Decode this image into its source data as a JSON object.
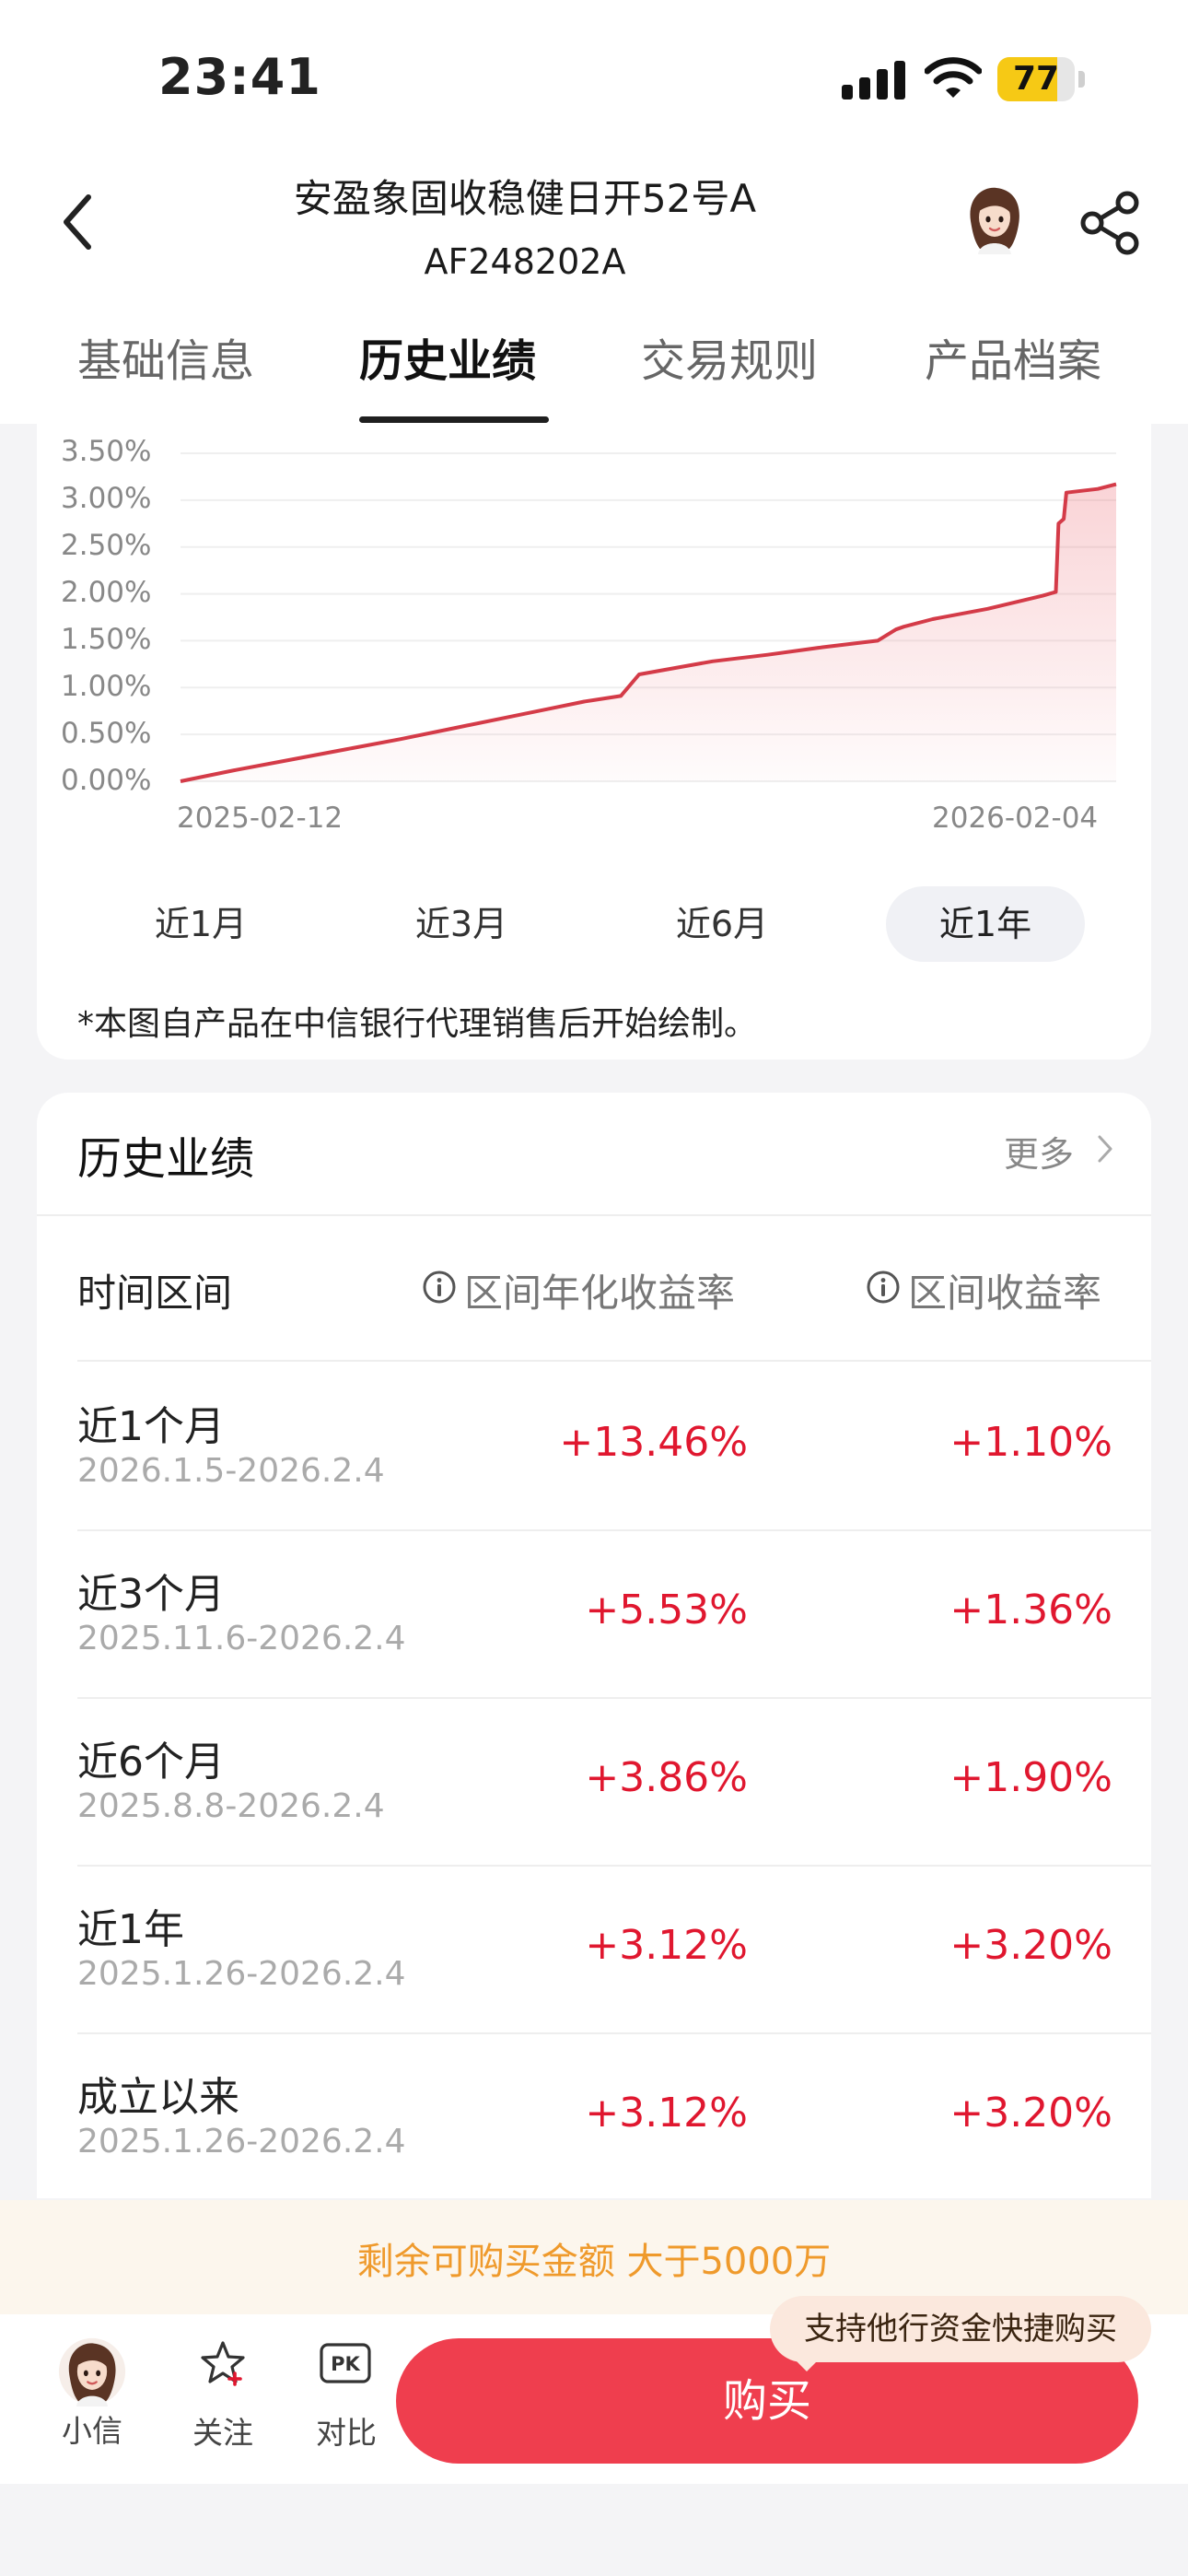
{
  "status_bar": {
    "time": "23:41",
    "battery": "77",
    "battery_level": 0.77
  },
  "header": {
    "back_icon": "chevron-left-icon",
    "title": "安盈象固收稳健日开52号A",
    "subtitle": "AF248202A",
    "share_icon": "share-icon"
  },
  "tabs": [
    {
      "label": "基础信息",
      "active": false
    },
    {
      "label": "历史业绩",
      "active": true
    },
    {
      "label": "交易规则",
      "active": false
    },
    {
      "label": "产品档案",
      "active": false
    }
  ],
  "chart_data": {
    "type": "area",
    "x_start": "2025-02-12",
    "x_end": "2026-02-04",
    "xtick_labels": [
      "2025-02-12",
      "2026-02-04"
    ],
    "ytick_labels": [
      "3.50%",
      "3.00%",
      "2.50%",
      "2.00%",
      "1.50%",
      "1.00%",
      "0.50%",
      "0.00%"
    ],
    "ylim": [
      0,
      3.5
    ],
    "color": "#d43b48",
    "series": [
      {
        "x": [
          "2025-02-12",
          "2025-03-05",
          "2025-03-26",
          "2025-04-16",
          "2025-05-07",
          "2025-05-28",
          "2025-06-18",
          "2025-07-02",
          "2025-07-16",
          "2025-07-30",
          "2025-08-06",
          "2025-08-20",
          "2025-09-03",
          "2025-09-24",
          "2025-10-15",
          "2025-11-05",
          "2025-11-12",
          "2025-11-15",
          "2025-11-26",
          "2025-12-17",
          "2026-01-07",
          "2026-01-12",
          "2026-01-13",
          "2026-01-15",
          "2026-01-16",
          "2026-01-28",
          "2026-02-04"
        ],
        "values": [
          0.0,
          0.12,
          0.23,
          0.34,
          0.45,
          0.57,
          0.69,
          0.77,
          0.85,
          0.91,
          1.14,
          1.21,
          1.28,
          1.35,
          1.43,
          1.5,
          1.62,
          1.65,
          1.73,
          1.84,
          1.98,
          2.02,
          2.75,
          2.8,
          3.08,
          3.12,
          3.17
        ]
      }
    ]
  },
  "range_buttons": [
    {
      "label": "近1月",
      "active": false
    },
    {
      "label": "近3月",
      "active": false
    },
    {
      "label": "近6月",
      "active": false
    },
    {
      "label": "近1年",
      "active": true
    }
  ],
  "chart_note": "*本图自产品在中信银行代理销售后开始绘制。",
  "performance": {
    "title": "历史业绩",
    "more": "更多",
    "col_period": "时间区间",
    "col_annual": "区间年化收益率",
    "col_return": "区间收益率",
    "rows": [
      {
        "label": "近1个月",
        "range": "2026.1.5-2026.2.4",
        "annual": "+13.46%",
        "ret": "+1.10%"
      },
      {
        "label": "近3个月",
        "range": "2025.11.6-2026.2.4",
        "annual": "+5.53%",
        "ret": "+1.36%"
      },
      {
        "label": "近6个月",
        "range": "2025.8.8-2026.2.4",
        "annual": "+3.86%",
        "ret": "+1.90%"
      },
      {
        "label": "近1年",
        "range": "2025.1.26-2026.2.4",
        "annual": "+3.12%",
        "ret": "+3.20%"
      },
      {
        "label": "成立以来",
        "range": "2025.1.26-2026.2.4",
        "annual": "+3.12%",
        "ret": "+3.20%"
      }
    ]
  },
  "remaining": "剩余可购买金额  大于5000万",
  "bottom_bar": {
    "assistant": "小信",
    "follow": "关注",
    "compare": "对比",
    "compare_badge": "PK",
    "buy": "购买",
    "bubble": "支持他行资金快捷购买"
  }
}
